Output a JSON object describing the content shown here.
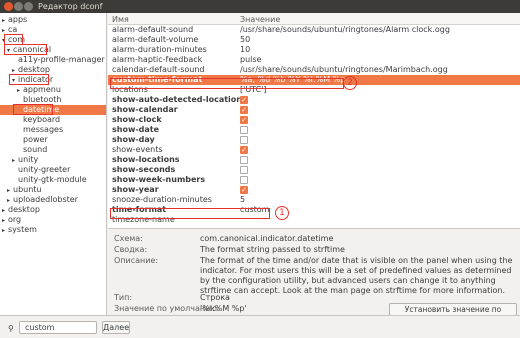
{
  "window": {
    "title": "Редактор dconf"
  },
  "tree": [
    {
      "label": "apps",
      "arrow": "▸"
    },
    {
      "label": "ca",
      "arrow": "▸"
    },
    {
      "label": "com",
      "arrow": "▾"
    },
    {
      "label": "canonical",
      "arrow": "▾"
    },
    {
      "label": "a11y-profile-manager",
      "arrow": ""
    },
    {
      "label": "desktop",
      "arrow": "▸"
    },
    {
      "label": "indicator",
      "arrow": "▾"
    },
    {
      "label": "appmenu",
      "arrow": "▸"
    },
    {
      "label": "bluetooth",
      "arrow": ""
    },
    {
      "label": "datetime",
      "arrow": ""
    },
    {
      "label": "keyboard",
      "arrow": ""
    },
    {
      "label": "messages",
      "arrow": ""
    },
    {
      "label": "power",
      "arrow": ""
    },
    {
      "label": "sound",
      "arrow": ""
    },
    {
      "label": "unity",
      "arrow": "▸"
    },
    {
      "label": "unity-greeter",
      "arrow": ""
    },
    {
      "label": "unity-gtk-module",
      "arrow": ""
    },
    {
      "label": "ubuntu",
      "arrow": "▸"
    },
    {
      "label": "uploadedlobster",
      "arrow": "▸"
    },
    {
      "label": "desktop",
      "arrow": "▸"
    },
    {
      "label": "org",
      "arrow": "▸"
    },
    {
      "label": "system",
      "arrow": "▸"
    }
  ],
  "list": {
    "header_name": "Имя",
    "header_value": "Значение",
    "rows": [
      {
        "name": "alarm-default-sound",
        "value": "/usr/share/sounds/ubuntu/ringtones/Alarm clock.ogg",
        "bold": false
      },
      {
        "name": "alarm-default-volume",
        "value": "50",
        "bold": false
      },
      {
        "name": "alarm-duration-minutes",
        "value": "10",
        "bold": false
      },
      {
        "name": "alarm-haptic-feedback",
        "value": "pulse",
        "bold": false
      },
      {
        "name": "calendar-default-sound",
        "value": "/usr/share/sounds/ubuntu/ringtones/Marimbach.ogg",
        "bold": false
      },
      {
        "name": "custom-time-format",
        "value": "%a, %d %b %Y %l:%M %p",
        "bold": true
      },
      {
        "name": "locations",
        "value": "['UTC']",
        "bold": false
      },
      {
        "name": "show-auto-detected-location",
        "check": true,
        "bold": true
      },
      {
        "name": "show-calendar",
        "check": true,
        "bold": true
      },
      {
        "name": "show-clock",
        "check": true,
        "bold": true
      },
      {
        "name": "show-date",
        "check": false,
        "bold": true
      },
      {
        "name": "show-day",
        "check": false,
        "bold": true
      },
      {
        "name": "show-events",
        "check": true,
        "bold": false
      },
      {
        "name": "show-locations",
        "check": false,
        "bold": true
      },
      {
        "name": "show-seconds",
        "check": false,
        "bold": true
      },
      {
        "name": "show-week-numbers",
        "check": false,
        "bold": true
      },
      {
        "name": "show-year",
        "check": true,
        "bold": true
      },
      {
        "name": "snooze-duration-minutes",
        "value": "5",
        "bold": false
      },
      {
        "name": "time-format",
        "value": "custom",
        "bold": true
      },
      {
        "name": "timezone-name",
        "value": "",
        "bold": false
      }
    ]
  },
  "details": {
    "schema_label": "Схема:",
    "schema_value": "com.canonical.indicator.datetime",
    "summary_label": "Сводка:",
    "summary_value": "The format string passed to strftime",
    "description_label": "Описание:",
    "description_value": "The format of the time and/or date that is visible on the panel when using the indicator. For most users this will be a set of predefined values as determined by the configuration utility, but advanced users can change it to anything strftime can accept. Look at the man page on strftime for more information.",
    "type_label": "Тип:",
    "type_value": "Строка",
    "default_label": "Значение по умолчанию:",
    "default_value": "'%l:%M %p'",
    "reset_button": "Установить значение по умолчанию"
  },
  "search": {
    "value": "custom",
    "next_button": "Далее"
  },
  "annotations": {
    "marker1": "1",
    "marker2": "2"
  },
  "colors": {
    "selection": "#f07746",
    "annotation": "#e8312a",
    "titlebar": "#3c3b37"
  }
}
